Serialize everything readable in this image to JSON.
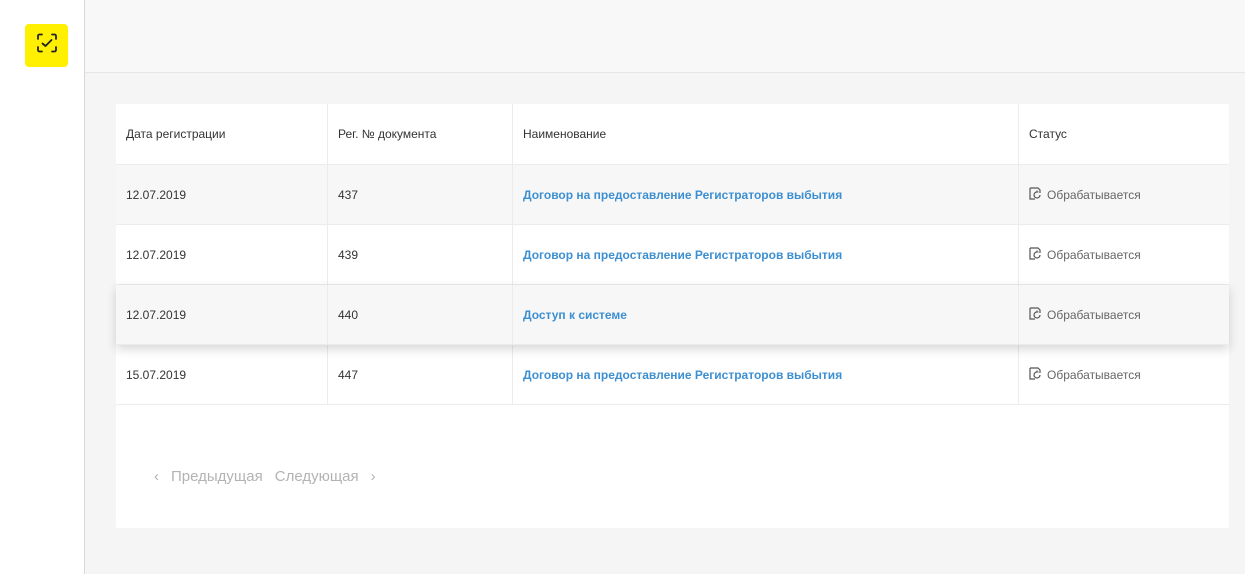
{
  "colors": {
    "brand_yellow": "#ffef00",
    "link_blue": "#3d8fd1",
    "muted_text": "#b3b3b3"
  },
  "sidebar": {
    "logo_icon": "scan-check-icon"
  },
  "table": {
    "headers": {
      "date": "Дата регистрации",
      "reg_no": "Рег. № документа",
      "name": "Наименование",
      "status": "Статус"
    },
    "rows": [
      {
        "date": "12.07.2019",
        "reg_no": "437",
        "name": "Договор на предоставление Регистраторов выбытия",
        "status": "Обрабатывается"
      },
      {
        "date": "12.07.2019",
        "reg_no": "439",
        "name": "Договор на предоставление Регистраторов выбытия",
        "status": "Обрабатывается"
      },
      {
        "date": "12.07.2019",
        "reg_no": "440",
        "name": "Доступ к системе",
        "status": "Обрабатывается"
      },
      {
        "date": "15.07.2019",
        "reg_no": "447",
        "name": "Договор на предоставление Регистраторов выбытия",
        "status": "Обрабатывается"
      }
    ],
    "status_icon": "document-processing-icon"
  },
  "pagination": {
    "prev_label": "Предыдущая",
    "next_label": "Следующая",
    "prev_icon": "chevron-left-icon",
    "next_icon": "chevron-right-icon"
  }
}
